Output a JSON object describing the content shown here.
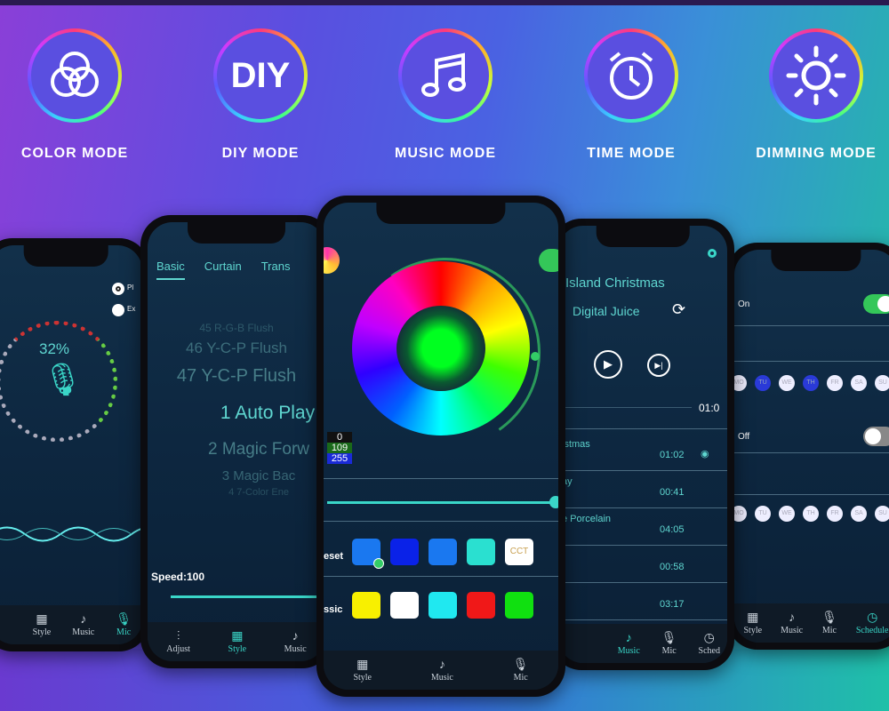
{
  "modes": [
    {
      "label": "COLOR MODE",
      "icon": "overlapping-circles-icon"
    },
    {
      "label": "DIY MODE",
      "icon": "diy-text-icon",
      "icon_text": "DIY"
    },
    {
      "label": "MUSIC MODE",
      "icon": "music-note-icon"
    },
    {
      "label": "TIME MODE",
      "icon": "alarm-clock-icon"
    },
    {
      "label": "DIMMING MODE",
      "icon": "sun-icon"
    }
  ],
  "mic_screen": {
    "percent": "32%",
    "radio1": "Pl",
    "radio2": "Ex",
    "tabs": [
      "Style",
      "Music",
      "Mic"
    ]
  },
  "style_screen": {
    "tabs": [
      "Basic",
      "Curtain",
      "Trans"
    ],
    "items": [
      "45 R-G-B Flush",
      "46 Y-C-P Flush",
      "47 Y-C-P Flush",
      "1 Auto Play",
      "2 Magic Forw",
      "3 Magic Bac",
      "4 7-Color Ene"
    ],
    "speed": "Speed:100",
    "tabbar": [
      "Adjust",
      "Style",
      "Music"
    ]
  },
  "color_screen": {
    "r": "0",
    "g": "109",
    "b": "255",
    "preset_label": "eset",
    "classic_label": "ssic",
    "cct": "CCT",
    "tabs": [
      "Style",
      "Music",
      "Mic"
    ],
    "preset_colors": [
      "#1a78f0",
      "#0a22e8",
      "#1a78f0",
      "#2ae0d0"
    ],
    "classic_colors": [
      "#f8f000",
      "#ffffff",
      "#20e8f0",
      "#f01818",
      "#10e010"
    ]
  },
  "music_screen": {
    "song": "Island Christmas",
    "artist": "Digital Juice",
    "elapsed": "01:0",
    "tracks": [
      {
        "title": "istmas",
        "time": "01:02"
      },
      {
        "title": "ay",
        "time": "00:41"
      },
      {
        "title": "e Porcelain",
        "time": "04:05"
      },
      {
        "title": "",
        "time": "00:58"
      },
      {
        "title": "",
        "time": "03:17"
      }
    ],
    "tabs": [
      "Music",
      "Mic",
      "Sched"
    ]
  },
  "schedule_screen": {
    "on_label": "On",
    "off_label": "Off",
    "days": [
      "MO",
      "TU",
      "WE",
      "TH",
      "FR",
      "SA",
      "SU"
    ],
    "tabs": [
      "Style",
      "Music",
      "Mic",
      "Schedule"
    ]
  },
  "colors": {
    "accent": "#3ad6c8",
    "toggle_on": "#34c759"
  }
}
